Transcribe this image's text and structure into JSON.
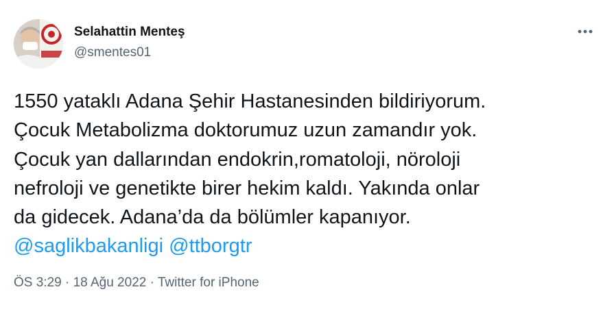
{
  "author": {
    "name": "Selahattin Menteş",
    "handle": "@smentes01",
    "avatar_icon": "profile-photo"
  },
  "more_icon": "more-options-icon",
  "tweet": {
    "lines": [
      "1550 yataklı Adana Şehir Hastanesinden bildiriyorum.",
      "Çocuk Metabolizma doktorumuz uzun zamandır yok.",
      "Çocuk yan dallarından endokrin,romatoloji, nöroloji",
      "nefroloji ve genetikte birer hekim kaldı. Yakında onlar",
      "da gidecek. Adana’da da bölümler kapanıyor."
    ],
    "mentions": [
      "@saglikbakanligi",
      "@ttborgtr"
    ]
  },
  "meta": {
    "time": "ÖS 3:29",
    "date": "18 Ağu 2022",
    "separator": "·",
    "source": "Twitter for iPhone"
  },
  "colors": {
    "link": "#1d9bf0",
    "secondary": "#536471",
    "text": "#0f1419"
  }
}
